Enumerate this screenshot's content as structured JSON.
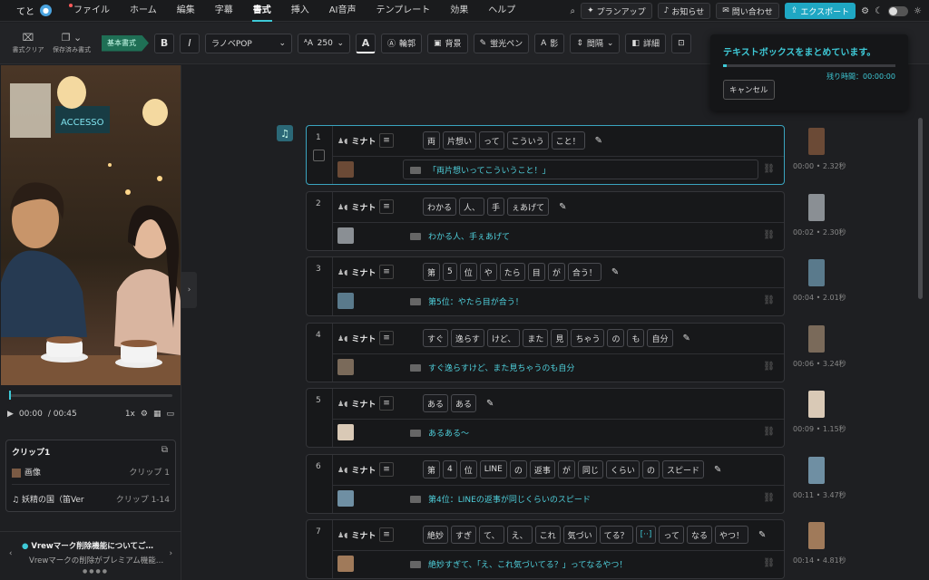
{
  "menubar": {
    "user": "てと",
    "items": [
      {
        "label": "ファイル",
        "dot": true
      },
      {
        "label": "ホーム"
      },
      {
        "label": "編集"
      },
      {
        "label": "字幕"
      },
      {
        "label": "書式",
        "active": true
      },
      {
        "label": "挿入"
      },
      {
        "label": "AI音声"
      },
      {
        "label": "テンプレート"
      },
      {
        "label": "効果"
      },
      {
        "label": "ヘルプ"
      }
    ],
    "plan_button": "プランアップ",
    "notice_button": "お知らせ",
    "contact_button": "問い合わせ",
    "export_button": "エクスポート"
  },
  "toolbar": {
    "clear_style": "書式クリア",
    "saved_style": "保存済み書式",
    "basic_style": "基本書式",
    "bold": "B",
    "italic": "I",
    "font": "ラノベPOP",
    "size": "250",
    "color": "A",
    "outline": "輪郭",
    "background": "背景",
    "highlighter": "蛍光ペン",
    "shadow": "影",
    "spacing": "間隔",
    "detail": "詳細"
  },
  "player": {
    "current_time": "00:00",
    "total_time": "/ 00:45",
    "speed": "1x"
  },
  "clip_panel": {
    "title": "クリップ1",
    "rows": [
      {
        "name": "画像",
        "value": "クリップ 1"
      },
      {
        "name": "妖精の国（笛Ver",
        "value": "クリップ 1-14"
      }
    ]
  },
  "notice": {
    "title": "Vrewマーク削除機能についてご…",
    "body": "Vrewマークの削除がプレミアム機能…"
  },
  "popup": {
    "title": "テキストボックスをまとめています。",
    "remaining": "残り時間：00:00:00",
    "cancel": "キャンセル"
  },
  "clips": [
    {
      "num": "1",
      "speaker": "ミナト",
      "words": [
        "両",
        "片想い",
        "って",
        "こういう",
        "こと！"
      ],
      "subtitle": "「両片想いってこういうこと！」",
      "time": "00:00 • 2.32秒",
      "thumb": "#6b4a36"
    },
    {
      "num": "2",
      "speaker": "ミナト",
      "words": [
        "わかる",
        "人、",
        "手",
        "ぇあげて"
      ],
      "subtitle": "わかる人、手ぇあげて",
      "time": "00:02 • 2.30秒",
      "thumb": "#8a8f94"
    },
    {
      "num": "3",
      "speaker": "ミナト",
      "words": [
        "第",
        "5",
        "位",
        "や",
        "たら",
        "目",
        "が",
        "合う！"
      ],
      "subtitle": "第5位：やたら目が合う！",
      "time": "00:04 • 2.01秒",
      "thumb": "#5a7a8c"
    },
    {
      "num": "4",
      "speaker": "ミナト",
      "words": [
        "すぐ",
        "逸らす",
        "けど、",
        "また",
        "見",
        "ちゃう",
        "の",
        "も",
        "自分"
      ],
      "subtitle": "すぐ逸らすけど、また見ちゃうのも自分",
      "time": "00:06 • 3.24秒",
      "thumb": "#7a6a5a"
    },
    {
      "num": "5",
      "speaker": "ミナト",
      "words": [
        "ある",
        "ある"
      ],
      "subtitle": "あるある〜",
      "time": "00:09 • 1.15秒",
      "thumb": "#d9c9b6"
    },
    {
      "num": "6",
      "speaker": "ミナト",
      "words": [
        "第",
        "4",
        "位",
        "LINE",
        "の",
        "返事",
        "が",
        "同じ",
        "くらい",
        "の",
        "スピード"
      ],
      "subtitle": "第4位：LINEの返事が同じくらいのスピード",
      "time": "00:11 • 3.47秒",
      "thumb": "#6f8fa3"
    },
    {
      "num": "7",
      "speaker": "ミナト",
      "words": [
        "絶妙",
        "すぎ",
        "て、",
        "え、",
        "これ",
        "気づい",
        "てる？",
        "[··]",
        "って",
        "なる",
        "やつ！"
      ],
      "subtitle": "絶妙すぎて、「え、これ気づいてる？」ってなるやつ！",
      "time": "00:14 • 4.81秒",
      "thumb": "#a07a5a"
    }
  ]
}
